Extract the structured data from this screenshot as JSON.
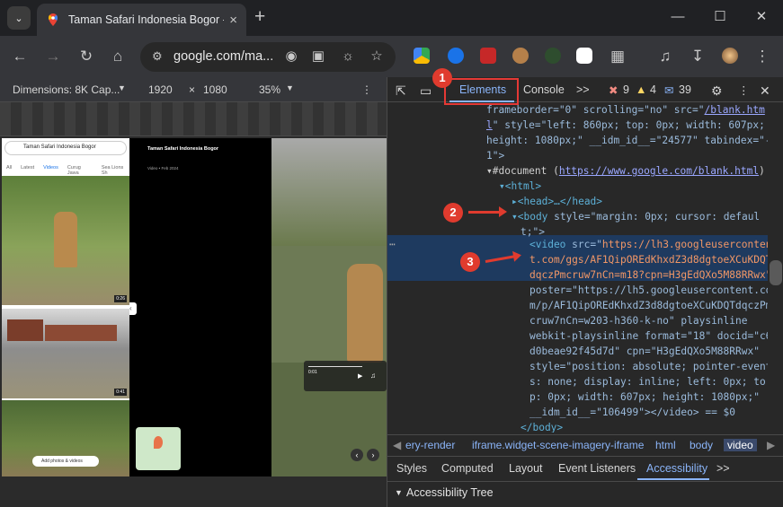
{
  "browser": {
    "tab_title": "Taman Safari Indonesia Bogor -",
    "tab_close": "×",
    "new_tab": "+",
    "window": {
      "minimize": "—",
      "maximize": "☐",
      "close": "✕"
    },
    "url": "google.com/ma..."
  },
  "device_toolbar": {
    "dimensions_label": "Dimensions: 8K Cap...",
    "width": "1920",
    "times": "×",
    "height": "1080",
    "zoom": "35%"
  },
  "page_preview": {
    "search_text": "Taman Safari Indonesia Bogor",
    "chips": [
      "All",
      "Latest",
      "Videos",
      "Curug Jawa",
      "Sea Lions Sh"
    ],
    "place_title": "Taman Safari Indonesia Bogor",
    "place_sub": "Video • Feb 2024",
    "thumb_times": [
      "0:26",
      "0:41"
    ],
    "add_photos": "Add photos & videos",
    "video_time": "0:01"
  },
  "devtools": {
    "tabs": {
      "elements": "Elements",
      "console": "Console",
      "more": ">>"
    },
    "counts": {
      "errors": "9",
      "warnings": "4",
      "messages": "39"
    },
    "dom_lines": {
      "l1_a": "frameborder=\"0\" scrolling=\"no\" src=\"",
      "l1_link": "/blank.htm",
      "l2_link": "l",
      "l2_rest": "\" style=\"left: 860px; top: 0px; width: 607px;",
      "l3": "height: 1080px;\" __idm_id__=\"24577\" tabindex=\"-",
      "l4": "1\">",
      "l5_a": "▾#document (",
      "l5_link": "https://www.google.com/blank.html",
      "l5_b": ")",
      "l6": "▾<html>",
      "l7": "▸<head>…</head>",
      "l8_a": "▾<body",
      "l8_b": " style=\"margin: 0px; cursor: defaul",
      "l9": "t;\">",
      "l10_a": "<video",
      "l10_b": " src=\"",
      "l10_c": "https://lh3.googleuserconten",
      "l11": "t.com/ggs/AF1QipOREdKhxdZ3d8dgtoeXCuKDQT",
      "l12": "dqczPmcruw7nCn=m18?cpn=H3gEdQXo5M88RRwx\"",
      "l13": "poster=\"https://lh5.googleusercontent.co",
      "l14": "m/p/AF1QipOREdKhxdZ3d8dgtoeXCuKDQTdqczPm",
      "l15": "cruw7nCn=w203-h360-k-no\" playsinline",
      "l16": "webkit-playsinline format=\"18\" docid=\"c6",
      "l17": "d0beae92f45d7d\" cpn=\"H3gEdQXo5M88RRwx\"",
      "l18": "style=\"position: absolute; pointer-event",
      "l19": "s: none; display: inline; left: 0px; to",
      "l20": "p: 0px; width: 607px; height: 1080px;\"",
      "l21": "__idm_id__=\"106499\"></video> == $0",
      "l22": "</body>"
    },
    "breadcrumbs": [
      "ery-render",
      "iframe.widget-scene-imagery-iframe",
      "html",
      "body",
      "video"
    ],
    "bottom_tabs": [
      "Styles",
      "Computed",
      "Layout",
      "Event Listeners",
      "Accessibility",
      ">>"
    ],
    "accessibility_tree": "Accessibility Tree"
  },
  "annotations": [
    "1",
    "2",
    "3"
  ],
  "colors": {
    "annotation": "#e03b2e",
    "selected": "#1e3a5f",
    "link": "#8ab4f8"
  }
}
